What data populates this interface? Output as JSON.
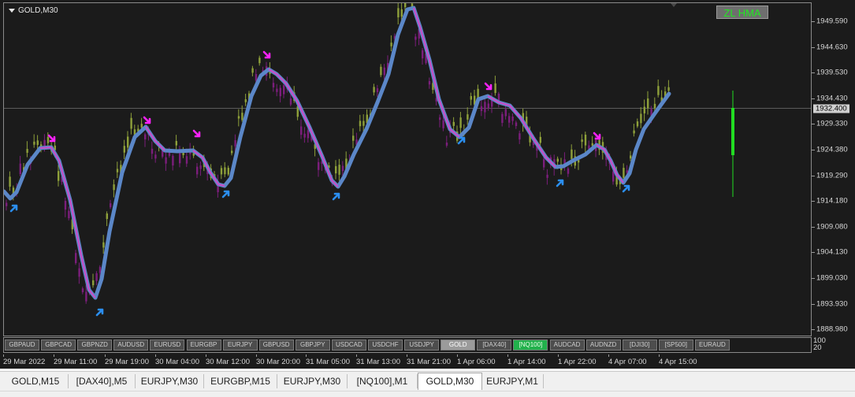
{
  "chart": {
    "symbol_title": "GOLD,M30",
    "indicator_button": "ZL HMA",
    "current_price": "1932.400",
    "price_labels": [
      "1949.590",
      "1944.630",
      "1939.530",
      "1934.430",
      "1929.330",
      "1924.380",
      "1919.290",
      "1914.180",
      "1909.080",
      "1904.130",
      "1899.030",
      "1893.930",
      "1888.980"
    ],
    "sub_axis_top": "100",
    "sub_axis_bottom": "20",
    "time_labels": [
      "29 Mar 2022",
      "29 Mar 11:00",
      "29 Mar 19:00",
      "30 Mar 04:00",
      "30 Mar 12:00",
      "30 Mar 20:00",
      "31 Mar 05:00",
      "31 Mar 13:00",
      "31 Mar 21:00",
      "1 Apr 06:00",
      "1 Apr 14:00",
      "1 Apr 22:00",
      "4 Apr 07:00",
      "4 Apr 15:00"
    ],
    "colors": {
      "background": "#1b1b1b",
      "bull_candle": "#8ea03a",
      "bear_candle": "#7c1e7c",
      "hma_line": "#5b87c8",
      "hma_down_overlay": "#c84fc8",
      "buy_arrow": "#2b8ef0",
      "sell_arrow": "#ff22ff",
      "volume_bar": "#22dd22"
    }
  },
  "symbol_buttons": [
    {
      "label": "GBPAUD",
      "state": "normal"
    },
    {
      "label": "GBPCAD",
      "state": "normal"
    },
    {
      "label": "GBPNZD",
      "state": "normal"
    },
    {
      "label": "AUDUSD",
      "state": "normal"
    },
    {
      "label": "EURUSD",
      "state": "normal"
    },
    {
      "label": "EURGBP",
      "state": "normal"
    },
    {
      "label": "EURJPY",
      "state": "normal"
    },
    {
      "label": "GBPUSD",
      "state": "normal"
    },
    {
      "label": "GBPJPY",
      "state": "normal"
    },
    {
      "label": "USDCAD",
      "state": "normal"
    },
    {
      "label": "USDCHF",
      "state": "normal"
    },
    {
      "label": "USDJPY",
      "state": "normal"
    },
    {
      "label": "GOLD",
      "state": "active"
    },
    {
      "label": "[DAX40]",
      "state": "normal"
    },
    {
      "label": "[NQ100]",
      "state": "green"
    },
    {
      "label": "AUDCAD",
      "state": "normal"
    },
    {
      "label": "AUDNZD",
      "state": "normal"
    },
    {
      "label": "[DJI30]",
      "state": "normal"
    },
    {
      "label": "[SP500]",
      "state": "normal"
    },
    {
      "label": "EURAUD",
      "state": "normal"
    }
  ],
  "tabs": [
    {
      "label": "GOLD,M15",
      "active": false
    },
    {
      "label": "[DAX40],M5",
      "active": false
    },
    {
      "label": "EURJPY,M30",
      "active": false
    },
    {
      "label": "EURGBP,M15",
      "active": false
    },
    {
      "label": "EURJPY,M30",
      "active": false
    },
    {
      "label": "[NQ100],M1",
      "active": false
    },
    {
      "label": "GOLD,M30",
      "active": true
    },
    {
      "label": "EURJPY,M1",
      "active": false
    }
  ]
}
